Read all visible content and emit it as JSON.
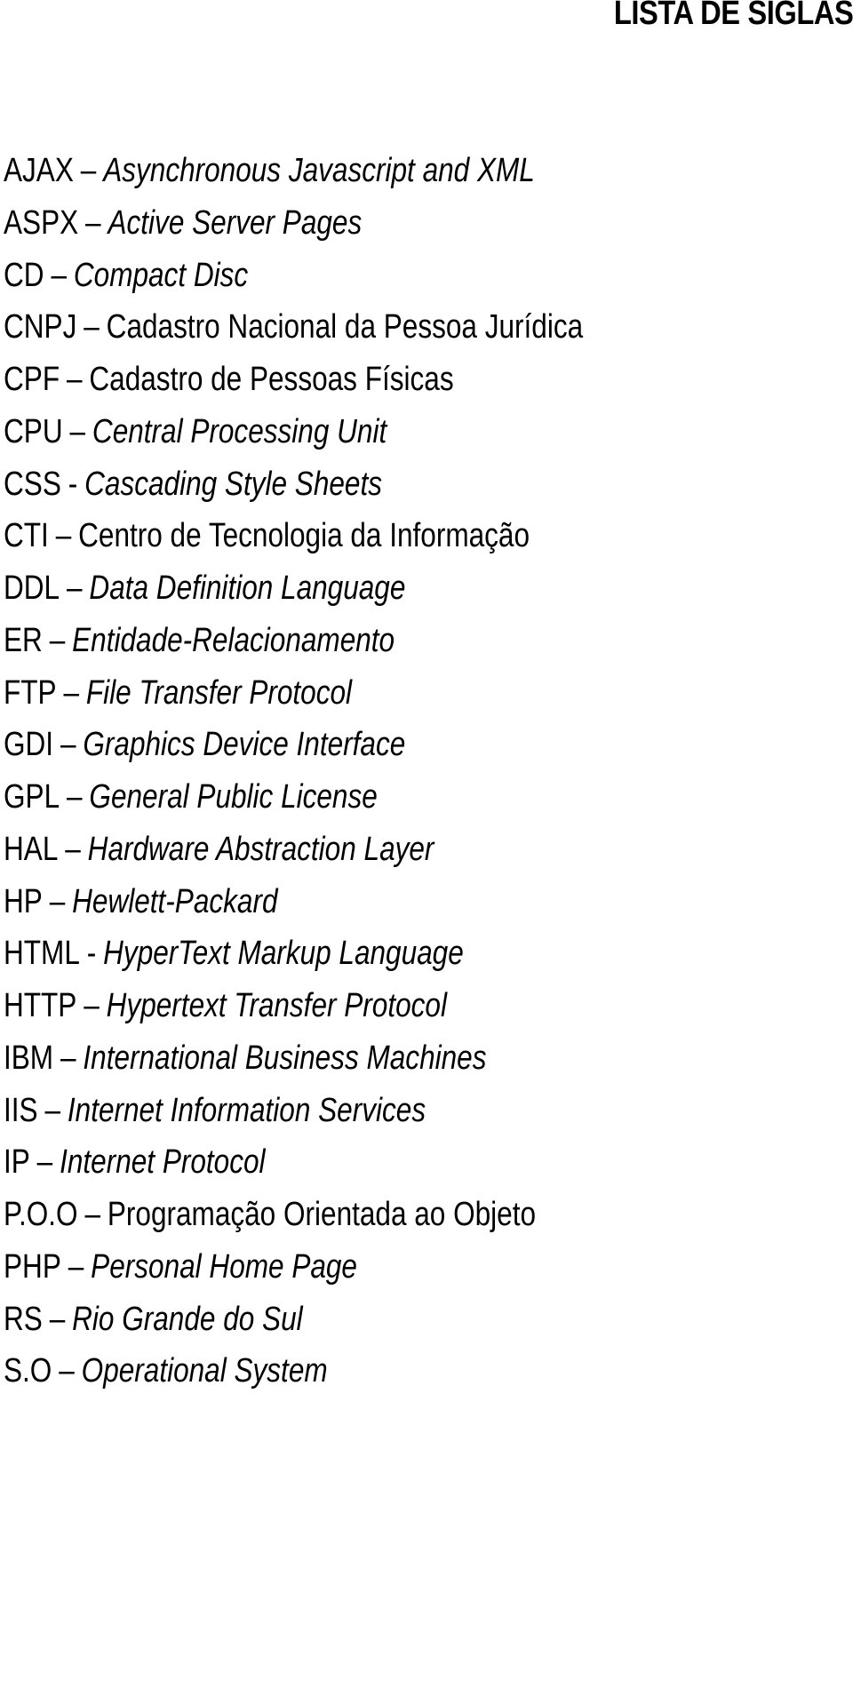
{
  "document": {
    "title": "LISTA DE SIGLAS",
    "entries": [
      {
        "acronym": "AJAX",
        "separator": "–",
        "meaning": "Asynchronous Javascript and XML",
        "italic": true
      },
      {
        "acronym": "ASPX",
        "separator": "–",
        "meaning": "Active Server Pages",
        "italic": true
      },
      {
        "acronym": "CD",
        "separator": "–",
        "meaning": "Compact Disc",
        "italic": true
      },
      {
        "acronym": "CNPJ",
        "separator": "–",
        "meaning": "Cadastro Nacional da Pessoa Jurídica",
        "italic": false
      },
      {
        "acronym": "CPF",
        "separator": "–",
        "meaning": "Cadastro de Pessoas Físicas",
        "italic": false
      },
      {
        "acronym": "CPU",
        "separator": "–",
        "meaning": "Central Processing Unit",
        "italic": true
      },
      {
        "acronym": "CSS",
        "separator": "-",
        "meaning": "Cascading Style Sheets",
        "italic": true
      },
      {
        "acronym": "CTI",
        "separator": "–",
        "meaning": "Centro de Tecnologia da Informação",
        "italic": false
      },
      {
        "acronym": "DDL",
        "separator": "–",
        "meaning": "Data Definition Language",
        "italic": true
      },
      {
        "acronym": "ER",
        "separator": "–",
        "meaning": "Entidade-Relacionamento",
        "italic": true
      },
      {
        "acronym": "FTP",
        "separator": "–",
        "meaning": "File Transfer Protocol",
        "italic": true
      },
      {
        "acronym": "GDI",
        "separator": "–",
        "meaning": "Graphics Device Interface",
        "italic": true
      },
      {
        "acronym": "GPL",
        "separator": "–",
        "meaning": "General Public License",
        "italic": true
      },
      {
        "acronym": "HAL",
        "separator": "–",
        "meaning": "Hardware Abstraction Layer",
        "italic": true
      },
      {
        "acronym": "HP",
        "separator": "–",
        "meaning": "Hewlett-Packard",
        "italic": true
      },
      {
        "acronym": "HTML",
        "separator": "-",
        "meaning": "HyperText Markup Language",
        "italic": true
      },
      {
        "acronym": "HTTP",
        "separator": "–",
        "meaning": "Hypertext Transfer Protocol",
        "italic": true
      },
      {
        "acronym": "IBM",
        "separator": "–",
        "meaning": "International Business Machines",
        "italic": true
      },
      {
        "acronym": "IIS",
        "separator": "–",
        "meaning": "Internet Information Services",
        "italic": true
      },
      {
        "acronym": "IP",
        "separator": "–",
        "meaning": "Internet Protocol",
        "italic": true
      },
      {
        "acronym": "P.O.O",
        "separator": "–",
        "meaning": "Programação Orientada ao Objeto",
        "italic": false
      },
      {
        "acronym": "PHP",
        "separator": "–",
        "meaning": "Personal Home Page",
        "italic": true
      },
      {
        "acronym": "RS",
        "separator": "–",
        "meaning": "Rio Grande do Sul",
        "italic": true
      },
      {
        "acronym": "S.O",
        "separator": "–",
        "meaning": "Operational System",
        "italic": true
      }
    ]
  }
}
